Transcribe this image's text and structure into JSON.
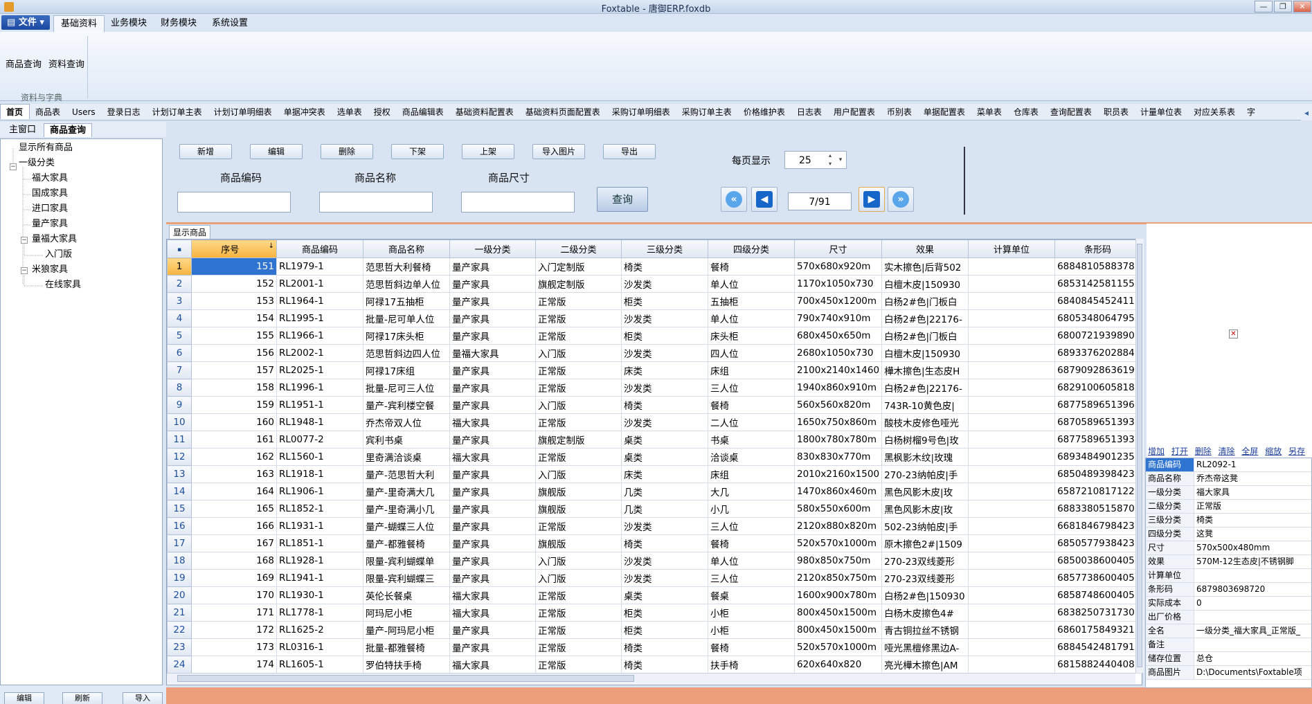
{
  "window": {
    "title": "Foxtable - 唐御ERP.foxdb",
    "min": "—",
    "max": "❐",
    "close": "✕"
  },
  "ribbon": {
    "file_label": "文件",
    "tabs": [
      "基础资料",
      "业务模块",
      "财务模块",
      "系统设置"
    ],
    "active_tab": 0,
    "buttons": [
      "商品查询",
      "资料查询"
    ],
    "group_label": "资料与字典"
  },
  "sheet_tabs": [
    "首页",
    "商品表",
    "Users",
    "登录日志",
    "计划订单主表",
    "计划订单明细表",
    "单据冲突表",
    "选单表",
    "授权",
    "商品编辑表",
    "基础资料配置表",
    "基础资料页面配置表",
    "采购订单明细表",
    "采购订单主表",
    "价格维护表",
    "日志表",
    "用户配置表",
    "币别表",
    "单据配置表",
    "菜单表",
    "仓库表",
    "查询配置表",
    "职员表",
    "计量单位表",
    "对应关系表",
    "字"
  ],
  "window_tabs": [
    "主窗口",
    "商品查询"
  ],
  "tree": {
    "nodes": [
      {
        "label": "显示所有商品"
      },
      {
        "label": "一级分类"
      },
      {
        "label": "福大家具"
      },
      {
        "label": "国成家具"
      },
      {
        "label": "进口家具"
      },
      {
        "label": "量产家具"
      },
      {
        "label": "量福大家具"
      },
      {
        "label": "入门版"
      },
      {
        "label": "米狼家具"
      },
      {
        "label": "在线家具"
      }
    ]
  },
  "bottom_buttons": [
    "编辑",
    "刷新",
    "导入"
  ],
  "query": {
    "buttons": [
      "新增",
      "编辑",
      "删除",
      "下架",
      "上架",
      "导入图片",
      "导出"
    ],
    "labels": [
      "商品编码",
      "商品名称",
      "商品尺寸"
    ],
    "search_label": "查询",
    "per_page_label": "每页显示",
    "per_page_value": "25",
    "page_indicator": "7/91"
  },
  "grid": {
    "tab_label": "显示商品",
    "columns": [
      "序号",
      "商品编码",
      "商品名称",
      "一级分类",
      "二级分类",
      "三级分类",
      "四级分类",
      "尺寸",
      "效果",
      "计算单位",
      "条形码"
    ],
    "rows": [
      [
        "151",
        "RL1979-1",
        "范思哲大利餐椅",
        "量产家具",
        "入门定制版",
        "椅类",
        "餐椅",
        "570x680x920m",
        "实木擦色|后背502",
        "",
        "6884810588378"
      ],
      [
        "152",
        "RL2001-1",
        "范思哲斜边单人位",
        "量产家具",
        "旗舰定制版",
        "沙发类",
        "单人位",
        "1170x1050x730",
        "白檀木皮|150930",
        "",
        "6853142581155"
      ],
      [
        "153",
        "RL1964-1",
        "阿禄17五抽柜",
        "量产家具",
        "正常版",
        "柜类",
        "五抽柜",
        "700x450x1200m",
        "白杨2#色|门板白",
        "",
        "6840845452411"
      ],
      [
        "154",
        "RL1995-1",
        "批量-尼可单人位",
        "量产家具",
        "正常版",
        "沙发类",
        "单人位",
        "790x740x910m",
        "白杨2#色|22176-",
        "",
        "6805348064795"
      ],
      [
        "155",
        "RL1966-1",
        "阿禄17床头柜",
        "量产家具",
        "正常版",
        "柜类",
        "床头柜",
        "680x450x650m",
        "白杨2#色|门板白",
        "",
        "6800721939890"
      ],
      [
        "156",
        "RL2002-1",
        "范思哲斜边四人位",
        "量福大家具",
        "入门版",
        "沙发类",
        "四人位",
        "2680x1050x730",
        "白檀木皮|150930",
        "",
        "6893376202884"
      ],
      [
        "157",
        "RL2025-1",
        "阿禄17床组",
        "量产家具",
        "正常版",
        "床类",
        "床组",
        "2100x2140x1460",
        "樺木擦色|生态皮H",
        "",
        "6879092863619"
      ],
      [
        "158",
        "RL1996-1",
        "批量-尼可三人位",
        "量产家具",
        "正常版",
        "沙发类",
        "三人位",
        "1940x860x910m",
        "白杨2#色|22176-",
        "",
        "6829100605818"
      ],
      [
        "159",
        "RL1951-1",
        "量产-宾利楼空餐",
        "量产家具",
        "入门版",
        "椅类",
        "餐椅",
        "560x560x820m",
        "743R-10黄色皮|",
        "",
        "6877589651396"
      ],
      [
        "160",
        "RL1948-1",
        "乔杰帝双人位",
        "福大家具",
        "正常版",
        "沙发类",
        "二人位",
        "1650x750x860m",
        "酸枝木皮修色哑光",
        "",
        "6870589651393"
      ],
      [
        "161",
        "RL0077-2",
        "宾利书桌",
        "量产家具",
        "旗舰定制版",
        "桌类",
        "书桌",
        "1800x780x780m",
        "白杨树榴9号色|玫",
        "",
        "6877589651393"
      ],
      [
        "162",
        "RL1560-1",
        "里奇满洽谈桌",
        "福大家具",
        "正常版",
        "桌类",
        "洽谈桌",
        "830x830x770m",
        "黑枫影木纹|玫瑰",
        "",
        "6893484901235"
      ],
      [
        "163",
        "RL1918-1",
        "量产-范思哲大利",
        "量产家具",
        "入门版",
        "床类",
        "床组",
        "2010x2160x1500",
        "270-23纳帕皮|手",
        "",
        "6850489398423"
      ],
      [
        "164",
        "RL1906-1",
        "量产-里奇满大几",
        "量产家具",
        "旗舰版",
        "几类",
        "大几",
        "1470x860x460m",
        "黑色风影木皮|玫",
        "",
        "6587210817122"
      ],
      [
        "165",
        "RL1852-1",
        "量产-里奇满小几",
        "量产家具",
        "旗舰版",
        "几类",
        "小几",
        "580x550x600m",
        "黑色风影木皮|玫",
        "",
        "6883380515870"
      ],
      [
        "166",
        "RL1931-1",
        "量产-蝴蝶三人位",
        "量产家具",
        "正常版",
        "沙发类",
        "三人位",
        "2120x880x820m",
        "502-23纳帕皮|手",
        "",
        "6681846798423"
      ],
      [
        "167",
        "RL1851-1",
        "量产-都雅餐椅",
        "量产家具",
        "旗舰版",
        "椅类",
        "餐椅",
        "520x570x1000m",
        "原木擦色2#|1509",
        "",
        "6850577938423"
      ],
      [
        "168",
        "RL1928-1",
        "限量-宾利蝴蝶单",
        "量产家具",
        "入门版",
        "沙发类",
        "单人位",
        "980x850x750m",
        "270-23双线菱形",
        "",
        "6850038600405"
      ],
      [
        "169",
        "RL1941-1",
        "限量-宾利蝴蝶三",
        "量产家具",
        "入门版",
        "沙发类",
        "三人位",
        "2120x850x750m",
        "270-23双线菱形",
        "",
        "6857738600405"
      ],
      [
        "170",
        "RL1930-1",
        "英伦长餐桌",
        "福大家具",
        "正常版",
        "桌类",
        "餐桌",
        "1600x900x780m",
        "白杨2#色|150930",
        "",
        "6858748600405"
      ],
      [
        "171",
        "RL1778-1",
        "阿玛尼小柜",
        "福大家具",
        "正常版",
        "柜类",
        "小柜",
        "800x450x1500m",
        "白杨木皮擦色4#",
        "",
        "6838250731730"
      ],
      [
        "172",
        "RL1625-2",
        "量产-阿玛尼小柜",
        "量产家具",
        "正常版",
        "柜类",
        "小柜",
        "800x450x1500m",
        "青古铜拉丝不锈钢",
        "",
        "6860175849321"
      ],
      [
        "173",
        "RL0316-1",
        "批量-都雅餐椅",
        "量产家具",
        "正常版",
        "椅类",
        "餐椅",
        "520x570x1000m",
        "哑光黑檀修黑边A-",
        "",
        "6884542481791"
      ],
      [
        "174",
        "RL1605-1",
        "罗伯特扶手椅",
        "福大家具",
        "正常版",
        "椅类",
        "扶手椅",
        "620x640x820",
        "亮光樺木擦色|AM",
        "",
        "6815882440408"
      ]
    ]
  },
  "detail": {
    "links": [
      "增加",
      "打开",
      "删除",
      "清除",
      "全屏",
      "缩放",
      "另存"
    ],
    "rows": [
      [
        "商品编码",
        "RL2092-1"
      ],
      [
        "商品名称",
        "乔杰帝这凳"
      ],
      [
        "一级分类",
        "福大家具"
      ],
      [
        "二级分类",
        "正常版"
      ],
      [
        "三级分类",
        "椅类"
      ],
      [
        "四级分类",
        "这凳"
      ],
      [
        "尺寸",
        "570x500x480mm"
      ],
      [
        "效果",
        "570M-12生态皮|不锈钢脚"
      ],
      [
        "计算单位",
        ""
      ],
      [
        "条形码",
        "6879803698720"
      ],
      [
        "实际成本",
        "0"
      ],
      [
        "出厂价格",
        ""
      ],
      [
        "全名",
        "一级分类_福大家具_正常版_"
      ],
      [
        "备注",
        ""
      ],
      [
        "储存位置",
        "总仓"
      ],
      [
        "商品图片",
        "D:\\Documents\\Foxtable项"
      ]
    ]
  }
}
